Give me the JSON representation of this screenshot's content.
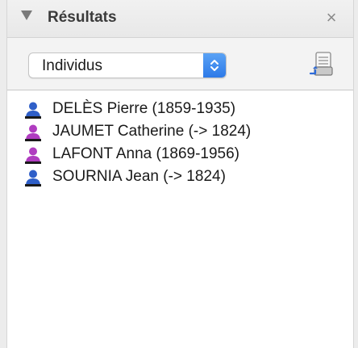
{
  "panel": {
    "title": "Résultats",
    "close_glyph": "×"
  },
  "toolbar": {
    "select_value": "Individus",
    "export_icon": "export-list-icon"
  },
  "results": [
    {
      "label": "DELÈS Pierre (1859-1935)",
      "sex": "male",
      "color": "#2f5fc8"
    },
    {
      "label": "JAUMET Catherine (-> 1824)",
      "sex": "female",
      "color": "#b03cc0"
    },
    {
      "label": "LAFONT Anna (1869-1956)",
      "sex": "female",
      "color": "#b03cc0"
    },
    {
      "label": "SOURNIA Jean (-> 1824)",
      "sex": "male",
      "color": "#2f5fc8"
    }
  ]
}
